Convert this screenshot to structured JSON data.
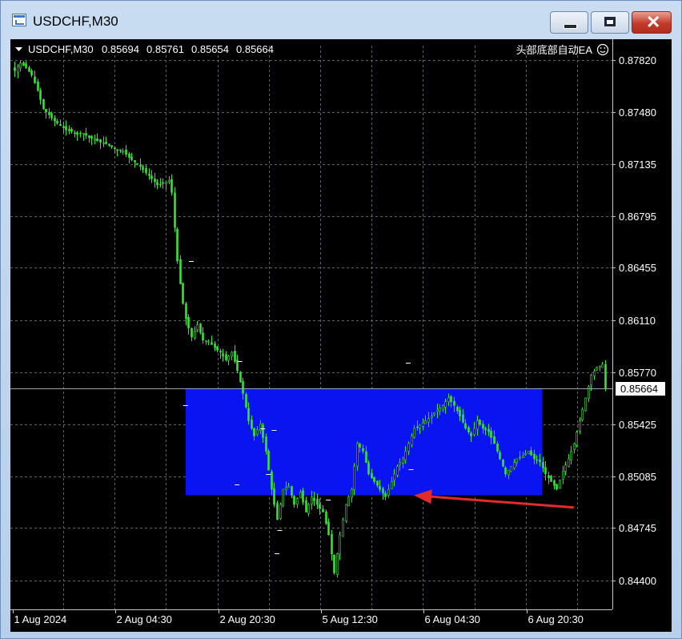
{
  "window": {
    "title": "USDCHF,M30",
    "controls": {
      "minimize_icon": "minimize-icon",
      "maximize_icon": "maximize-icon",
      "close_icon": "close-icon"
    }
  },
  "chart_data": {
    "type": "candlestick",
    "symbol": "USDCHF,M30",
    "ohlc_values": [
      "0.85694",
      "0.85761",
      "0.85654",
      "0.85664"
    ],
    "indicator_label": "头部底部自动EA",
    "current_price": "0.85664",
    "yticks": [
      "0.87820",
      "0.87480",
      "0.87135",
      "0.86795",
      "0.86455",
      "0.86110",
      "0.85770",
      "0.85425",
      "0.85085",
      "0.84745",
      "0.84400"
    ],
    "xticks": [
      "1 Aug 2024",
      "2 Aug 04:30",
      "2 Aug 20:30",
      "5 Aug 12:30",
      "6 Aug 04:30",
      "6 Aug 20:30"
    ],
    "ylim": [
      0.8431,
      0.8795
    ],
    "close_path": [
      [
        0,
        0.8775
      ],
      [
        2,
        0.878
      ],
      [
        4,
        0.8777
      ],
      [
        6,
        0.8772
      ],
      [
        8,
        0.8762
      ],
      [
        10,
        0.875
      ],
      [
        12,
        0.8746
      ],
      [
        14,
        0.8742
      ],
      [
        16,
        0.8739
      ],
      [
        18,
        0.8736
      ],
      [
        20,
        0.8735
      ],
      [
        22,
        0.8733
      ],
      [
        24,
        0.8734
      ],
      [
        26,
        0.8731
      ],
      [
        28,
        0.873
      ],
      [
        30,
        0.8728
      ],
      [
        32,
        0.8727
      ],
      [
        34,
        0.8725
      ],
      [
        36,
        0.8723
      ],
      [
        38,
        0.8722
      ],
      [
        40,
        0.8718
      ],
      [
        42,
        0.8715
      ],
      [
        44,
        0.8712
      ],
      [
        46,
        0.8708
      ],
      [
        48,
        0.8704
      ],
      [
        50,
        0.87
      ],
      [
        52,
        0.8701
      ],
      [
        54,
        0.8703
      ],
      [
        55,
        0.8695
      ],
      [
        56,
        0.8672
      ],
      [
        57,
        0.865
      ],
      [
        58,
        0.8635
      ],
      [
        59,
        0.8622
      ],
      [
        60,
        0.8612
      ],
      [
        62,
        0.86
      ],
      [
        64,
        0.8608
      ],
      [
        66,
        0.8598
      ],
      [
        68,
        0.8597
      ],
      [
        70,
        0.8593
      ],
      [
        72,
        0.859
      ],
      [
        74,
        0.8585
      ],
      [
        76,
        0.859
      ],
      [
        78,
        0.8578
      ],
      [
        80,
        0.8563
      ],
      [
        82,
        0.8545
      ],
      [
        84,
        0.8535
      ],
      [
        86,
        0.8543
      ],
      [
        88,
        0.8525
      ],
      [
        90,
        0.85
      ],
      [
        92,
        0.848
      ],
      [
        94,
        0.85
      ],
      [
        96,
        0.8502
      ],
      [
        98,
        0.849
      ],
      [
        100,
        0.8498
      ],
      [
        102,
        0.8485
      ],
      [
        104,
        0.8495
      ],
      [
        106,
        0.849
      ],
      [
        108,
        0.8485
      ],
      [
        110,
        0.847
      ],
      [
        112,
        0.8445
      ],
      [
        114,
        0.847
      ],
      [
        116,
        0.849
      ],
      [
        118,
        0.85
      ],
      [
        120,
        0.853
      ],
      [
        122,
        0.8525
      ],
      [
        124,
        0.851
      ],
      [
        126,
        0.8505
      ],
      [
        128,
        0.85
      ],
      [
        130,
        0.8495
      ],
      [
        132,
        0.8505
      ],
      [
        134,
        0.8515
      ],
      [
        136,
        0.852
      ],
      [
        138,
        0.853
      ],
      [
        140,
        0.854
      ],
      [
        142,
        0.8542
      ],
      [
        144,
        0.8545
      ],
      [
        146,
        0.8548
      ],
      [
        148,
        0.8552
      ],
      [
        150,
        0.8555
      ],
      [
        152,
        0.856
      ],
      [
        154,
        0.8555
      ],
      [
        156,
        0.8548
      ],
      [
        158,
        0.854
      ],
      [
        160,
        0.8535
      ],
      [
        162,
        0.8545
      ],
      [
        164,
        0.854
      ],
      [
        166,
        0.8538
      ],
      [
        168,
        0.853
      ],
      [
        170,
        0.852
      ],
      [
        172,
        0.851
      ],
      [
        174,
        0.8515
      ],
      [
        176,
        0.852
      ],
      [
        178,
        0.8522
      ],
      [
        180,
        0.8525
      ],
      [
        182,
        0.852
      ],
      [
        184,
        0.8518
      ],
      [
        186,
        0.851
      ],
      [
        188,
        0.8505
      ],
      [
        190,
        0.85
      ],
      [
        192,
        0.8512
      ],
      [
        194,
        0.852
      ],
      [
        196,
        0.853
      ],
      [
        198,
        0.8545
      ],
      [
        200,
        0.856
      ],
      [
        202,
        0.8575
      ],
      [
        204,
        0.858
      ],
      [
        206,
        0.8582
      ],
      [
        207,
        0.8566
      ]
    ],
    "buy_zone": {
      "x_range": [
        60,
        185
      ],
      "price_range": [
        0.8496,
        0.85664
      ]
    },
    "arrow": {
      "from": [
        196,
        0.8488
      ],
      "to": [
        140,
        0.8496
      ]
    }
  }
}
